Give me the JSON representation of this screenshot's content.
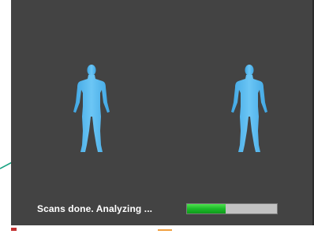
{
  "window": {
    "background_color": "#434343"
  },
  "figures": [
    {
      "name": "body-figure-icon",
      "color": "#5ab8ee"
    },
    {
      "name": "body-figure-icon",
      "color": "#5ab8ee"
    }
  ],
  "status": {
    "text": "Scans done. Analyzing ..."
  },
  "progress": {
    "value_fraction": 0.43,
    "fill_color": "#1dbb2a",
    "track_color": "#c2c2c2"
  },
  "annotation": {
    "line_color": "#1aa383"
  }
}
